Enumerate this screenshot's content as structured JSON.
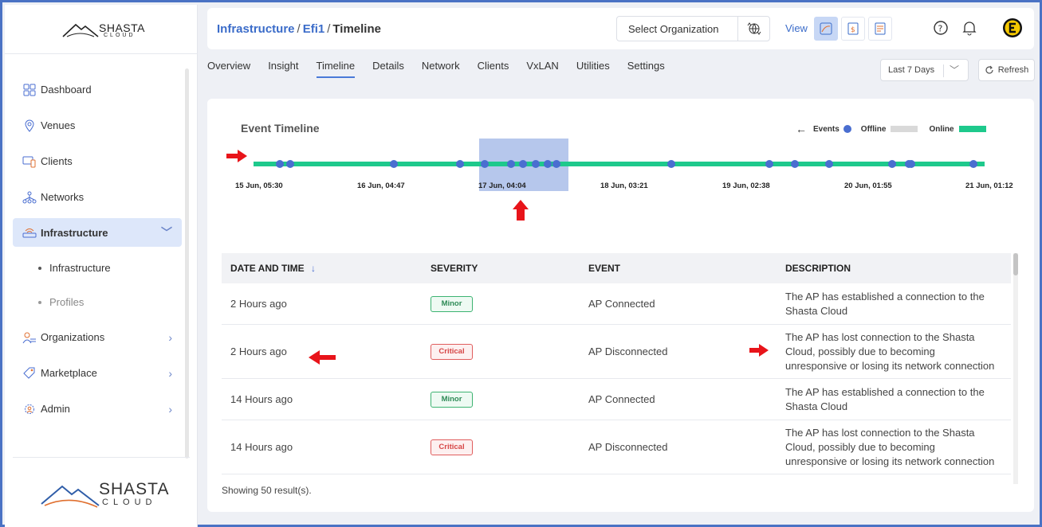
{
  "brand": {
    "name": "SHASTA",
    "sub": "CLOUD"
  },
  "sidebar": {
    "items": [
      {
        "label": "Dashboard",
        "icon": "dashboard-icon"
      },
      {
        "label": "Venues",
        "icon": "location-pin-icon"
      },
      {
        "label": "Clients",
        "icon": "devices-icon"
      },
      {
        "label": "Networks",
        "icon": "network-icon"
      },
      {
        "label": "Infrastructure",
        "icon": "router-icon",
        "active": true
      },
      {
        "label": "Organizations",
        "icon": "organization-icon"
      },
      {
        "label": "Marketplace",
        "icon": "tag-icon"
      },
      {
        "label": "Admin",
        "icon": "admin-gear-icon"
      }
    ],
    "sub_items": [
      {
        "label": "Infrastructure"
      },
      {
        "label": "Profiles"
      }
    ]
  },
  "header": {
    "breadcrumb": [
      "Infrastructure",
      "Efi1",
      "Timeline"
    ],
    "org_select_label": "Select Organization",
    "view_label": "View"
  },
  "tabs": [
    "Overview",
    "Insight",
    "Timeline",
    "Details",
    "Network",
    "Clients",
    "VxLAN",
    "Utilities",
    "Settings"
  ],
  "active_tab": "Timeline",
  "controls": {
    "range": "Last 7 Days",
    "refresh": "Refresh"
  },
  "timeline": {
    "title": "Event Timeline",
    "legend": {
      "events": "Events",
      "offline": "Offline",
      "online": "Online"
    },
    "labels": [
      "15 Jun, 05:30",
      "16 Jun, 04:47",
      "17 Jun, 04:04",
      "18 Jun, 03:21",
      "19 Jun, 02:38",
      "20 Jun, 01:55",
      "21 Jun, 01:12"
    ],
    "colors": {
      "online": "#1ec98c",
      "event": "#4a6ed0",
      "selection": "#a9bde9"
    }
  },
  "table": {
    "headers": {
      "date": "DATE AND TIME",
      "severity": "SEVERITY",
      "event": "EVENT",
      "description": "DESCRIPTION"
    },
    "rows": [
      {
        "date": "2 Hours ago",
        "severity": "Minor",
        "event": "AP Connected",
        "desc1": "The AP has established a connection to the",
        "desc2": "Shasta Cloud",
        "desc3": ""
      },
      {
        "date": "2 Hours ago",
        "severity": "Critical",
        "event": "AP Disconnected",
        "desc1": "The AP has lost connection to the Shasta",
        "desc2": "Cloud, possibly due to becoming",
        "desc3": "unresponsive or losing its network connection"
      },
      {
        "date": "14 Hours ago",
        "severity": "Minor",
        "event": "AP Connected",
        "desc1": "The AP has established a connection to the",
        "desc2": "Shasta Cloud",
        "desc3": ""
      },
      {
        "date": "14 Hours ago",
        "severity": "Critical",
        "event": "AP Disconnected",
        "desc1": "The AP has lost connection to the Shasta",
        "desc2": "Cloud, possibly due to becoming",
        "desc3": "unresponsive or losing its network connection"
      }
    ],
    "results": "Showing 50 result(s)."
  }
}
